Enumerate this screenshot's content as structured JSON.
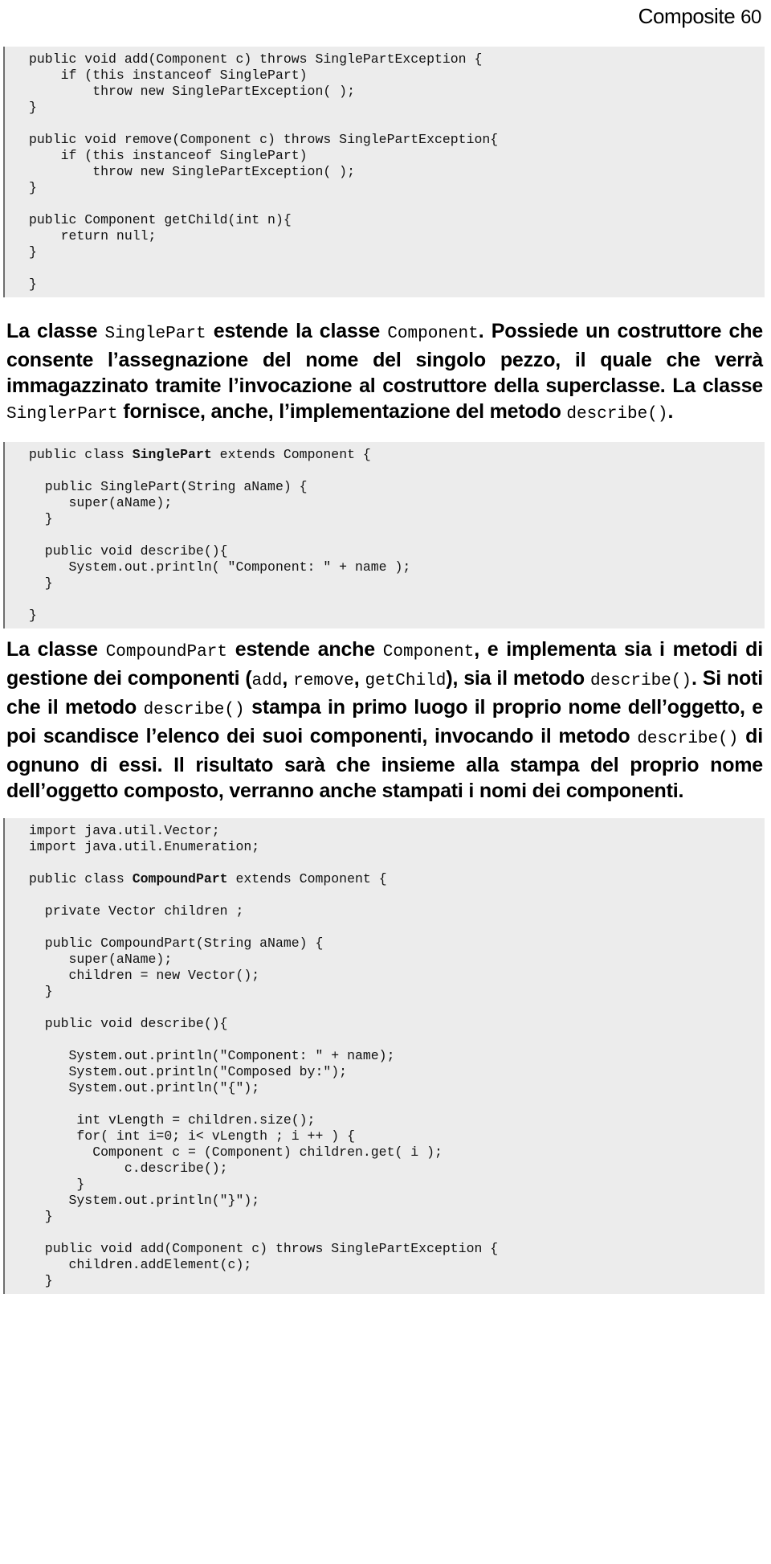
{
  "header": {
    "chapter": "Composite",
    "page_number": "60"
  },
  "code_blocks": {
    "component_methods": [
      "public void add(Component c) throws SinglePartException {",
      "    if (this instanceof SinglePart)",
      "        throw new SinglePartException( );",
      "}",
      "",
      "public void remove(Component c) throws SinglePartException{",
      "    if (this instanceof SinglePart)",
      "        throw new SinglePartException( );",
      "}",
      "",
      "public Component getChild(int n){",
      "    return null;",
      "}",
      "",
      "}"
    ],
    "single_part_class": [
      "public class §SinglePart§ extends Component {",
      "",
      "  public SinglePart(String aName) {",
      "     super(aName);",
      "  }",
      "",
      "  public void describe(){",
      "     System.out.println( \"Component: \" + name );",
      "  }",
      "",
      "}"
    ],
    "compound_part_class": [
      "import java.util.Vector;",
      "import java.util.Enumeration;",
      "",
      "public class §CompoundPart§ extends Component {",
      "",
      "  private Vector children ;",
      "",
      "  public CompoundPart(String aName) {",
      "     super(aName);",
      "     children = new Vector();",
      "  }",
      "",
      "  public void describe(){",
      "",
      "     System.out.println(\"Component: \" + name);",
      "     System.out.println(\"Composed by:\");",
      "     System.out.println(\"{\");",
      "",
      "      int vLength = children.size();",
      "      for( int i=0; i< vLength ; i ++ ) {",
      "        Component c = (Component) children.get( i );",
      "            c.describe();",
      "      }",
      "     System.out.println(\"}\");",
      "  }",
      "",
      "  public void add(Component c) throws SinglePartException {",
      "     children.addElement(c);",
      "  }"
    ]
  },
  "paragraphs": {
    "p1": {
      "s1": "La classe ",
      "c1": "SinglePart",
      "s2": " estende la classe ",
      "c2": "Component",
      "s3": ". Possiede un costruttore che consente l’assegnazione del nome del singolo pezzo, il quale che verrà immagazzinato tramite l’invocazione al costruttore della superclasse. La classe ",
      "c3": "SinglerPart",
      "s4": " fornisce, anche, l’implementazione del metodo ",
      "c4": "describe()",
      "s5": "."
    },
    "p2": {
      "s1": "La classe ",
      "c1": "CompoundPart",
      "s2": " estende anche ",
      "c2": "Component",
      "s3": ", e implementa sia i metodi di gestione dei componenti (",
      "c3": "add",
      "s4": ", ",
      "c4": "remove",
      "s5": ", ",
      "c5": "getChild",
      "s6": "), sia il metodo ",
      "c6": "describe()",
      "s7": ". Si noti che il metodo ",
      "c7": "describe()",
      "s8": " stampa in primo luogo il proprio nome dell’oggetto, e poi scandisce l’elenco dei suoi componenti, invocando il metodo ",
      "c8": "describe()",
      "s9": " di ognuno di essi. Il risultato sarà che insieme alla stampa del proprio nome dell’oggetto composto, verranno anche stampati i nomi dei componenti."
    }
  },
  "colors": {
    "code_background": "#ececec",
    "code_border": "#6e6e6e",
    "text": "#000000"
  }
}
